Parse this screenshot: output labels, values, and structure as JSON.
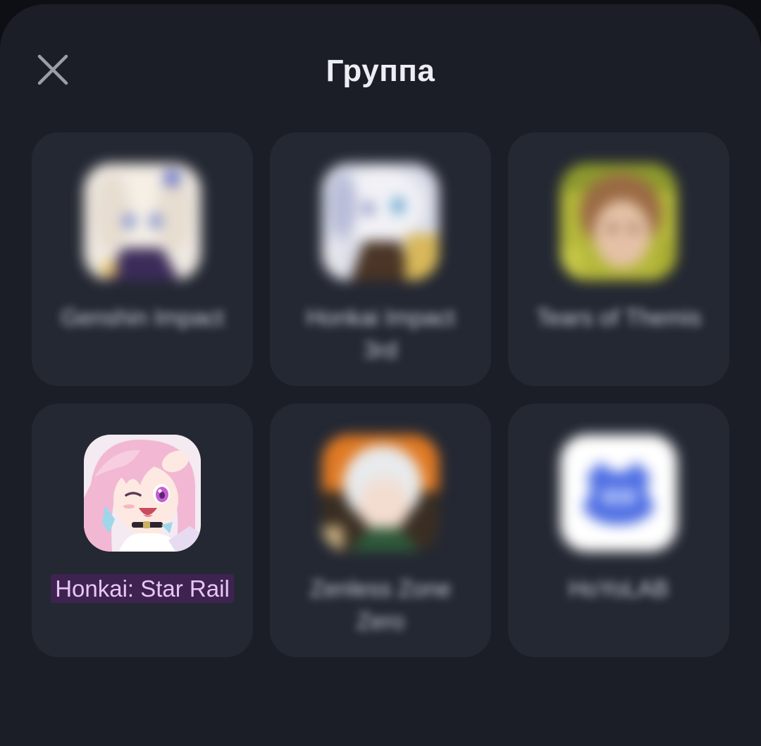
{
  "header": {
    "title": "Группа",
    "close_icon": "close-icon"
  },
  "apps": [
    {
      "label": "Genshin Impact",
      "icon": "genshin-impact-app-icon",
      "obscured": true
    },
    {
      "label": "Honkai Impact 3rd",
      "icon": "honkai-impact-3rd-app-icon",
      "obscured": true
    },
    {
      "label": "Tears of Themis",
      "icon": "tears-of-themis-app-icon",
      "obscured": true
    },
    {
      "label": "Honkai: Star Rail",
      "icon": "honkai-star-rail-app-icon",
      "obscured": false,
      "highlighted": true
    },
    {
      "label": "Zenless Zone Zero",
      "icon": "zenless-zone-zero-app-icon",
      "obscured": true
    },
    {
      "label": "HoYoLAB",
      "icon": "hoyolab-app-icon",
      "obscured": true
    }
  ],
  "colors": {
    "background": "#0e0f14",
    "sheet": "#1b1e27",
    "tile": "#242833",
    "highlight_bg": "#3e2350",
    "highlight_text": "#e9c6f5"
  }
}
